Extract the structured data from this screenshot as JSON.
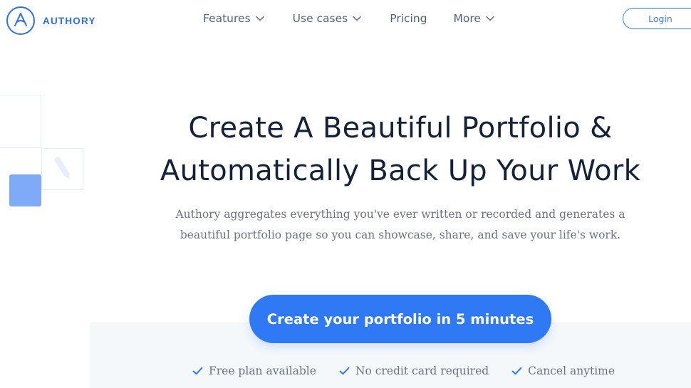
{
  "brand": {
    "name": "AUTHORY",
    "accent_color": "#2f6fe4"
  },
  "nav": {
    "items": [
      {
        "label": "Features",
        "has_dropdown": true,
        "icon": "chevron-down-icon"
      },
      {
        "label": "Use cases",
        "has_dropdown": true,
        "icon": "chevron-down-icon"
      },
      {
        "label": "Pricing",
        "has_dropdown": false
      },
      {
        "label": "More",
        "has_dropdown": true,
        "icon": "chevron-down-icon"
      }
    ],
    "login_label": "Login"
  },
  "hero": {
    "title_line1": "Create A Beautiful Portfolio &",
    "title_line2": "Automatically Back Up Your Work",
    "subtitle_line1": "Authory aggregates everything you've ever written or recorded and generates a",
    "subtitle_line2": "beautiful portfolio page so you can showcase, share, and save your life's work."
  },
  "cta": {
    "button_label": "Create your portfolio in 5 minutes",
    "button_color": "#2f79f4"
  },
  "features": [
    {
      "label": "Free plan available",
      "icon": "check-icon"
    },
    {
      "label": "No credit card required",
      "icon": "check-icon"
    },
    {
      "label": "Cancel anytime",
      "icon": "check-icon"
    }
  ],
  "decor": {
    "icons": [
      "pencil-icon"
    ],
    "solid_color": "#7eaaf8"
  }
}
